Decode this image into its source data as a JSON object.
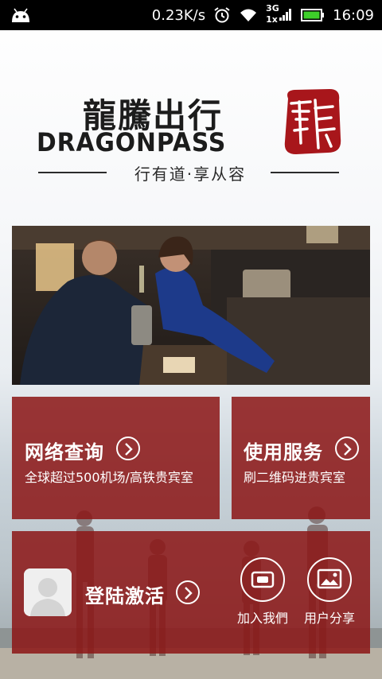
{
  "status_bar": {
    "speed": "0.23K/s",
    "network_top": "3G",
    "network_bottom": "1x",
    "time": "16:09",
    "icons": [
      "android-icon",
      "alarm-icon",
      "wifi-icon",
      "signal-icon",
      "battery-icon"
    ]
  },
  "brand": {
    "name_cn": "龍騰出行",
    "name_en": "DRAGONPASS",
    "slogan": "行有道·享从容",
    "seal_char": "龍",
    "seal_color": "#a8161b"
  },
  "hero": {
    "image": "airport-lounge-photo"
  },
  "tiles": {
    "search": {
      "title": "网络查询",
      "subtitle": "全球超过500机场/高铁贵宾室"
    },
    "service": {
      "title": "使用服务",
      "subtitle": "刷二维码进贵宾室"
    },
    "login": {
      "title": "登陆激活"
    }
  },
  "actions": {
    "join": {
      "label": "加入我們",
      "icon": "card-icon"
    },
    "share": {
      "label": "用户分享",
      "icon": "picture-icon"
    }
  },
  "colors": {
    "tile_bg": "#8c1616",
    "status_bar": "#000000",
    "battery": "#3ecf2a"
  }
}
